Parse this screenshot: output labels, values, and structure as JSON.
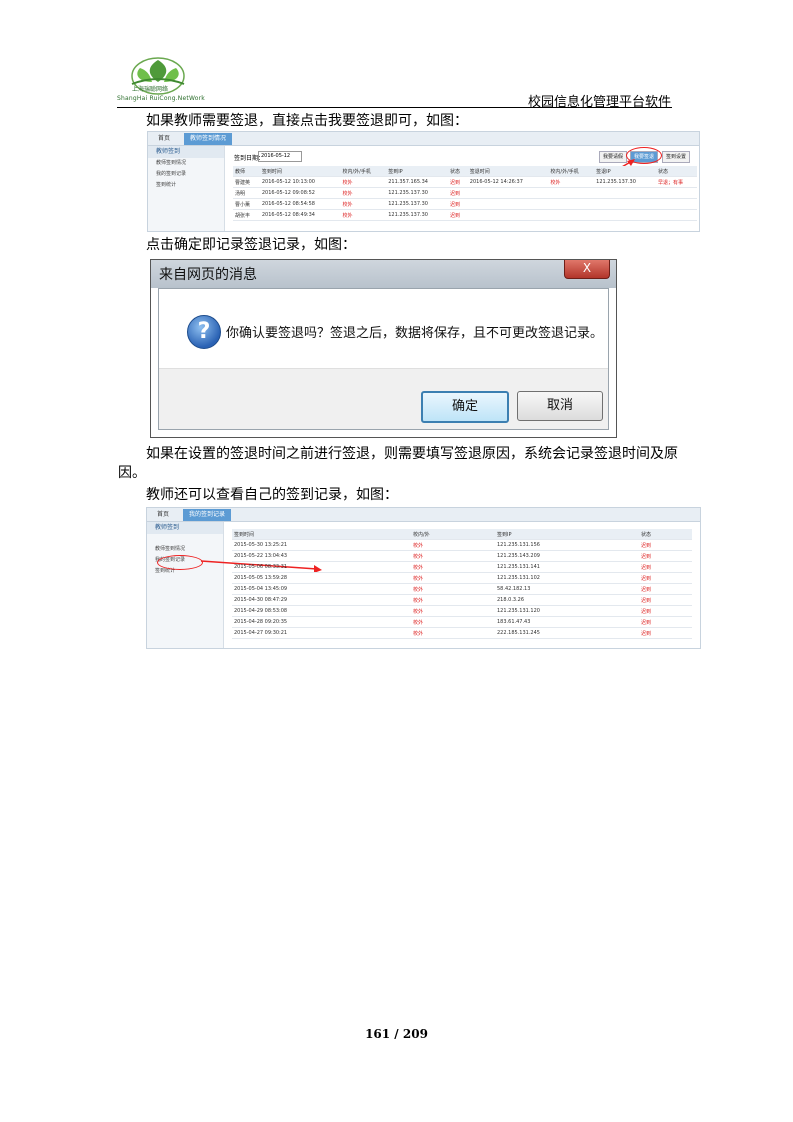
{
  "header": {
    "logo_cn": "上海瑞聪网络",
    "logo_en": "ShangHai RuiCong.NetWork",
    "title": "校园信息化管理平台软件"
  },
  "paragraphs": {
    "p1": "如果教师需要签退，直接点击我要签退即可，如图：",
    "p2": "点击确定即记录签退记录，如图：",
    "p3a": "如果在设置的签退时间之前进行签退，则需要填写签退原因，系统会记录签退时间及原",
    "p3b": "因。",
    "p4": "教师还可以查看自己的签到记录，如图："
  },
  "shot1": {
    "tabs": [
      "首页",
      "教师签到情况"
    ],
    "sidebar_title": "教师签到",
    "sidebar_items": [
      "教师签到情况",
      "我的签到记录",
      "签到统计"
    ],
    "date_label": "签到日期：",
    "date_value": "2016-05-12",
    "buttons": [
      "我要请假",
      "我要签退",
      "签到设置"
    ],
    "columns": [
      "教师",
      "签到时间",
      "校内/外/手机",
      "签到IP",
      "状态",
      "签退时间",
      "校内/外/手机",
      "签退IP",
      "状态"
    ],
    "rows": [
      [
        "曹建英",
        "2016-05-12 10:13:00",
        "校外",
        "211.357.165.34",
        "迟到",
        "2016-05-12 14:26:37",
        "校外",
        "121.235.137.30",
        "早退；有事"
      ],
      [
        "汤明",
        "2016-05-12 09:08:52",
        "校外",
        "121.235.137.30",
        "迟到",
        "",
        "",
        "",
        ""
      ],
      [
        "曹小薰",
        "2016-05-12 08:54:58",
        "校外",
        "121.235.137.30",
        "迟到",
        "",
        "",
        "",
        ""
      ],
      [
        "胡张丰",
        "2016-05-12 08:49:34",
        "校外",
        "121.235.137.30",
        "迟到",
        "",
        "",
        "",
        ""
      ]
    ]
  },
  "dialog": {
    "title": "来自网页的消息",
    "close": "X",
    "icon": "?",
    "message": "你确认要签退吗？签退之后，数据将保存，且不可更改签退记录。",
    "ok": "确定",
    "cancel": "取消"
  },
  "shot2": {
    "tabs": [
      "首页",
      "我的签到记录"
    ],
    "sidebar_title": "教师签到",
    "sidebar_items": [
      "教师签到情况",
      "我的签到记录",
      "签到统计"
    ],
    "columns": [
      "签到时间",
      "校内/外",
      "签到IP",
      "状态"
    ],
    "rows": [
      [
        "2015-05-30 13:25:21",
        "校外",
        "121.235.131.156",
        "迟到"
      ],
      [
        "2015-05-22 13:04:43",
        "校外",
        "121.235.143.209",
        "迟到"
      ],
      [
        "2015-05-06 08:33:31",
        "校外",
        "121.235.131.141",
        "迟到"
      ],
      [
        "2015-05-05 13:59:28",
        "校外",
        "121.235.131.102",
        "迟到"
      ],
      [
        "2015-05-04 13:45:09",
        "校外",
        "58.42.182.13",
        "迟到"
      ],
      [
        "2015-04-30 08:47:29",
        "校外",
        "218.0.3.26",
        "迟到"
      ],
      [
        "2015-04-29 08:53:08",
        "校外",
        "121.235.131.120",
        "迟到"
      ],
      [
        "2015-04-28 09:20:35",
        "校外",
        "183.61.47.43",
        "迟到"
      ],
      [
        "2015-04-27 09:30:21",
        "校外",
        "222.185.131.245",
        "迟到"
      ]
    ]
  },
  "footer": {
    "page": "161 / 209"
  }
}
